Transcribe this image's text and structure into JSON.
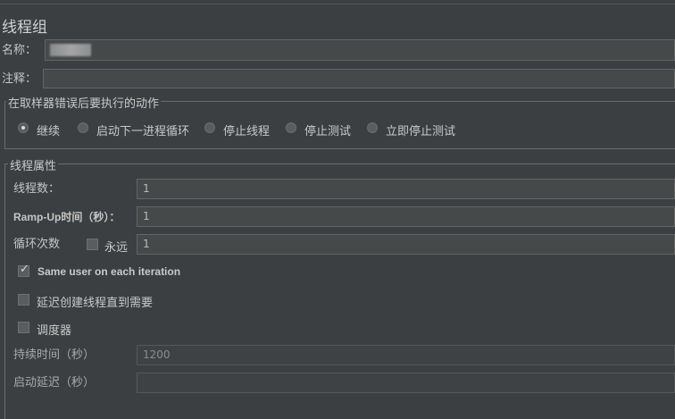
{
  "panel": {
    "title": "线程组"
  },
  "name_field": {
    "label": "名称：",
    "value": ""
  },
  "comment_field": {
    "label": "注释：",
    "value": ""
  },
  "sampler_error": {
    "title": "在取样器错误后要执行的动作",
    "options": [
      {
        "label": "继续",
        "selected": true
      },
      {
        "label": "启动下一进程循环",
        "selected": false
      },
      {
        "label": "停止线程",
        "selected": false
      },
      {
        "label": "停止测试",
        "selected": false
      },
      {
        "label": "立即停止测试",
        "selected": false
      }
    ]
  },
  "thread_props": {
    "title": "线程属性",
    "num_threads": {
      "label": "线程数：",
      "value": "1"
    },
    "ramp_up": {
      "label": "Ramp-Up时间（秒）：",
      "value": "1"
    },
    "loop_count": {
      "label": "循环次数",
      "forever_label": "永远",
      "forever_checked": false,
      "value": "1"
    },
    "same_user": {
      "label": "Same user on each iteration",
      "checked": true
    },
    "delay_create": {
      "label": "延迟创建线程直到需要",
      "checked": false
    },
    "scheduler": {
      "label": "调度器",
      "checked": false
    },
    "duration": {
      "label": "持续时间（秒）",
      "value": "1200"
    },
    "startup_delay": {
      "label": "启动延迟（秒）",
      "value": ""
    }
  }
}
